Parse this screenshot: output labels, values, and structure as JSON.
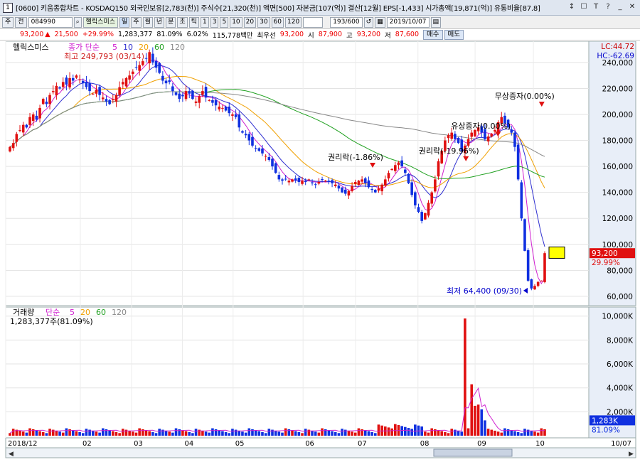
{
  "window": {
    "number": "1",
    "title": "[0600] 키움종합차트 - KOSDAQ150 외국인보유[2,783(천)] 주식수[21,320(천)] 액면[500] 자본금[107(억)] 결산[12월] EPS[-1,433] 시가총액[19,871(억)] 유통비율[87.8]",
    "buttons": [
      "↕",
      "☐",
      "T",
      "?",
      "_",
      "✕"
    ]
  },
  "toolbar": {
    "mode": "주",
    "mode2": "전",
    "code": "084990",
    "stock_name": "헬릭스미스",
    "tag": "일",
    "periods": [
      "주",
      "월",
      "년",
      "분",
      "초",
      "틱"
    ],
    "intervals": [
      "1",
      "3",
      "5",
      "10",
      "20",
      "30",
      "60",
      "120"
    ],
    "count": "193",
    "count_total": "/600",
    "date": "2019/10/07"
  },
  "price": {
    "last": "93,200",
    "change": "21,500",
    "change_pct": "+29.99%",
    "volume": "1,283,377",
    "vol_ratio": "81.09%",
    "turnover": "6.02%",
    "amount": "115,778백만",
    "best": "최우선",
    "best_price": "93,200",
    "open_label": "시",
    "open": "87,900",
    "high_label": "고",
    "high": "93,200",
    "low_label": "저",
    "low": "87,600",
    "buy": "매수",
    "sell": "매도"
  },
  "chart_data": [
    {
      "type": "candlestick",
      "title": "헬릭스미스",
      "legend": {
        "label": "종가 단순",
        "ma": [
          {
            "name": "5",
            "color": "#d020d0"
          },
          {
            "name": "10",
            "color": "#3030d0"
          },
          {
            "name": "20",
            "color": "#f0a000"
          },
          {
            "name": "60",
            "color": "#20a020"
          },
          {
            "name": "120",
            "color": "#888888"
          }
        ]
      },
      "high_note": "최고 249,793 (03/14)",
      "low_note": "최저 64,400 (09/30)",
      "lc": "LC:44.72",
      "hc": "HC:-62.69",
      "ylim": [
        55000,
        252000
      ],
      "yticks": [
        {
          "v": 60000,
          "label": "60,000"
        },
        {
          "v": 80000,
          "label": "80,000"
        },
        {
          "v": 100000,
          "label": "100,000"
        },
        {
          "v": 120000,
          "label": "120,000"
        },
        {
          "v": 140000,
          "label": "140,000"
        },
        {
          "v": 160000,
          "label": "160,000"
        },
        {
          "v": 180000,
          "label": "180,000"
        },
        {
          "v": 200000,
          "label": "200,000"
        },
        {
          "v": 220000,
          "label": "220,000"
        },
        {
          "v": 240000,
          "label": "240,000"
        }
      ],
      "last_price_label": "93,200",
      "last_pct_label": "29.99%",
      "annotations": [
        {
          "text": "권리락(-1.86%)",
          "x": 0.6,
          "v": 165000
        },
        {
          "text": "권리락(-19.96%)",
          "x": 0.76,
          "v": 170000
        },
        {
          "text": "유상증자(0.00%)",
          "x": 0.815,
          "v": 189000
        },
        {
          "text": "무상증자(0.00%)",
          "x": 0.89,
          "v": 212000
        }
      ],
      "closes": [
        175000,
        178000,
        185000,
        188000,
        192000,
        190000,
        198000,
        200000,
        196000,
        205000,
        212000,
        208000,
        215000,
        218000,
        222000,
        220000,
        225000,
        223000,
        228000,
        226000,
        230000,
        227000,
        224000,
        221000,
        218000,
        216000,
        219000,
        215000,
        213000,
        210000,
        208000,
        212000,
        215000,
        221000,
        225000,
        228000,
        230000,
        233000,
        236000,
        238000,
        241000,
        243000,
        248000,
        240000,
        236000,
        232000,
        226000,
        224000,
        225000,
        218000,
        215000,
        212000,
        214000,
        218000,
        216000,
        212000,
        210000,
        214000,
        218000,
        213000,
        211000,
        209000,
        207000,
        206000,
        205000,
        203000,
        201000,
        200000,
        198000,
        190000,
        186000,
        184000,
        180000,
        176000,
        174000,
        172000,
        170000,
        168000,
        165000,
        160000,
        155000,
        150000,
        149000,
        150000,
        149000,
        150000,
        149000,
        148000,
        149000,
        148000,
        150000,
        147000,
        146000,
        148000,
        150000,
        149000,
        148000,
        147000,
        146000,
        143000,
        140000,
        139000,
        141000,
        145000,
        148000,
        149000,
        150000,
        147000,
        144000,
        142000,
        140000,
        143000,
        146000,
        150000,
        155000,
        158000,
        161000,
        163000,
        160000,
        155000,
        147000,
        138000,
        130000,
        125000,
        118000,
        124000,
        132000,
        140000,
        150000,
        164000,
        172000,
        180000,
        184000,
        186000,
        181000,
        178000,
        172000,
        176000,
        181000,
        186000,
        188000,
        190000,
        186000,
        181000,
        183000,
        185000,
        188000,
        194000,
        198000,
        193000,
        190000,
        186000,
        175000,
        150000,
        120000,
        95000,
        72000,
        66000,
        68000,
        71000,
        72000,
        93200
      ],
      "ma_colors": [
        "#d020d0",
        "#3030d0",
        "#f0a000",
        "#20a020",
        "#888888"
      ]
    },
    {
      "type": "bar",
      "title": "거래량",
      "legend": {
        "label": "단순",
        "ma": [
          {
            "name": "5",
            "color": "#d020d0"
          },
          {
            "name": "20",
            "color": "#f0a000"
          },
          {
            "name": "60",
            "color": "#20a020"
          },
          {
            "name": "120",
            "color": "#888888"
          }
        ]
      },
      "subtitle": "1,283,377주(81.09%)",
      "ylim": [
        0,
        10400000
      ],
      "yticks": [
        {
          "v": 2000000,
          "label": "2,000K"
        },
        {
          "v": 4000000,
          "label": "4,000K"
        },
        {
          "v": 6000000,
          "label": "6,000K"
        },
        {
          "v": 8000000,
          "label": "8,000K"
        },
        {
          "v": 10000000,
          "label": "10,000K"
        }
      ],
      "last_label": "1,283K",
      "last_pct": "81.09%",
      "spikes": [
        {
          "i": 137,
          "v": 9800000
        },
        {
          "i": 139,
          "v": 4300000
        },
        {
          "i": 140,
          "v": 2500000
        },
        {
          "i": 141,
          "v": 2600000
        },
        {
          "i": 142,
          "v": 2200000
        },
        {
          "i": 143,
          "v": 1283377
        }
      ]
    }
  ],
  "xaxis": {
    "labels": [
      {
        "t": "2018/12",
        "x": 0.0
      },
      {
        "t": "02",
        "x": 0.128
      },
      {
        "t": "03",
        "x": 0.216
      },
      {
        "t": "04",
        "x": 0.303
      },
      {
        "t": "05",
        "x": 0.39
      },
      {
        "t": "06",
        "x": 0.51
      },
      {
        "t": "07",
        "x": 0.6
      },
      {
        "t": "08",
        "x": 0.707
      },
      {
        "t": "09",
        "x": 0.805
      },
      {
        "t": "10",
        "x": 0.905
      }
    ],
    "end": "10/07"
  }
}
